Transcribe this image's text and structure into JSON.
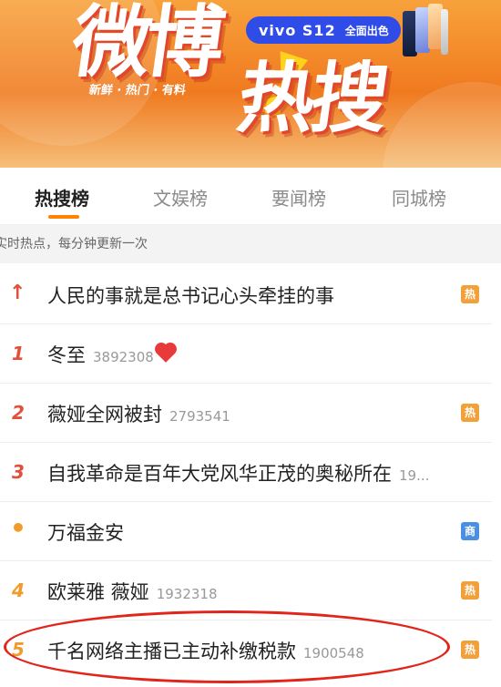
{
  "banner": {
    "brand_main": "微博",
    "brand_hot": "热搜",
    "tagline": "新鲜 · 热门 · 有料",
    "ad_brand": "vivo S12",
    "ad_slogan": "全面出色"
  },
  "tabs": [
    {
      "label": "热搜榜",
      "active": true
    },
    {
      "label": "文娱榜",
      "active": false
    },
    {
      "label": "要闻榜",
      "active": false
    },
    {
      "label": "同城榜",
      "active": false
    }
  ],
  "subtitle": "实时热点，每分钟更新一次",
  "rows": [
    {
      "rank": "",
      "title": "人民的事就是总书记心头牵挂的事",
      "heat": "",
      "badge": "热",
      "badge_type": "hot",
      "icon": "pin-up-arrow-icon"
    },
    {
      "rank": "1",
      "title": "冬至",
      "heat": "3892308",
      "badge": "",
      "badge_type": "",
      "icon": "heart-icon"
    },
    {
      "rank": "2",
      "title": "薇娅全网被封",
      "heat": "2793541",
      "badge": "热",
      "badge_type": "hot",
      "icon": ""
    },
    {
      "rank": "3",
      "title": "自我革命是百年大党风华正茂的奥秘所在",
      "heat": "19...",
      "badge": "",
      "badge_type": "",
      "icon": ""
    },
    {
      "rank": "•",
      "title": "万福金安",
      "heat": "",
      "badge": "商",
      "badge_type": "biz",
      "icon": ""
    },
    {
      "rank": "4",
      "title": "欧莱雅 薇娅",
      "heat": "1932318",
      "badge": "热",
      "badge_type": "hot",
      "icon": ""
    },
    {
      "rank": "5",
      "title": "千名网络主播已主动补缴税款",
      "heat": "1900548",
      "badge": "热",
      "badge_type": "hot",
      "icon": ""
    }
  ],
  "colors": {
    "accent": "#ff8200",
    "rank_red": "#e2503c",
    "rank_orange": "#f39b2a",
    "hot_badge": "#f2a03a",
    "biz_badge": "#4a90e2",
    "annotation": "#e1251b"
  }
}
